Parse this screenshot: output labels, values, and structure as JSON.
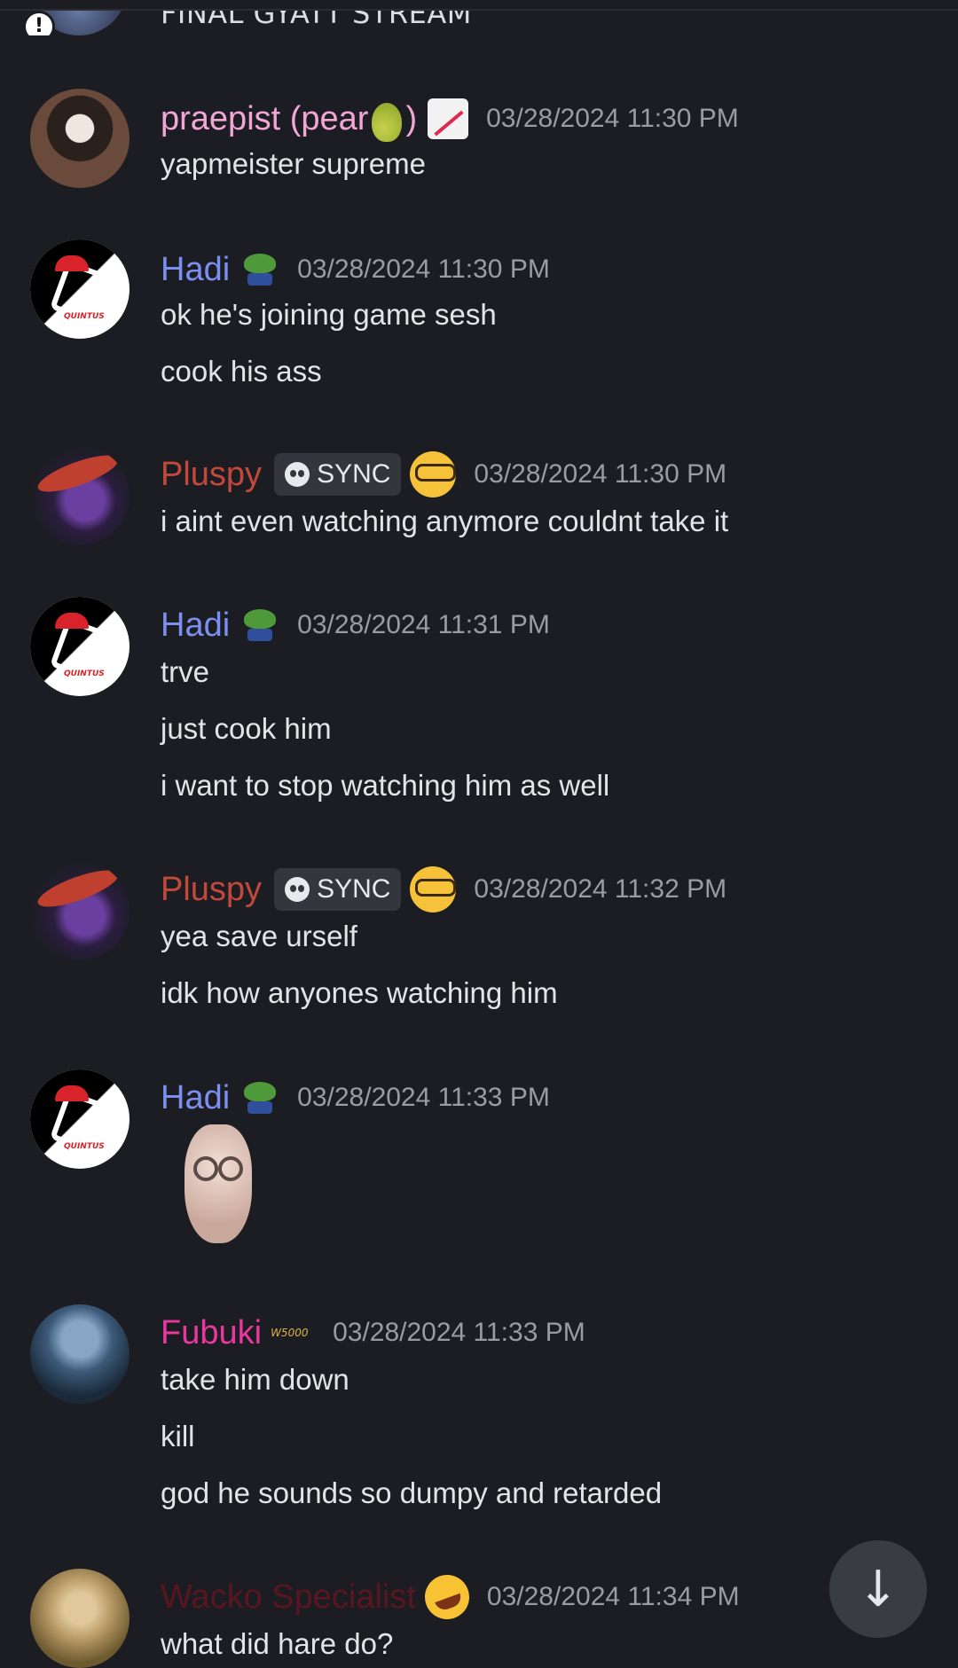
{
  "partial_message": {
    "text": "FINAL GYATT STREAM"
  },
  "messages": [
    {
      "username": "praepist (pear",
      "username_suffix": ")",
      "user_color": "#f1a6d6",
      "timestamp": "03/28/2024 11:30 PM",
      "lines": [
        "yapmeister supreme"
      ]
    },
    {
      "username": "Hadi",
      "user_color": "#7b8ff0",
      "timestamp": "03/28/2024 11:30 PM",
      "lines": [
        "ok he's joining game sesh",
        "cook his ass"
      ]
    },
    {
      "username": "Pluspy",
      "user_color": "#c3483c",
      "tag": "SYNC",
      "timestamp": "03/28/2024 11:30 PM",
      "lines": [
        "i aint even watching anymore couldnt take it"
      ]
    },
    {
      "username": "Hadi",
      "user_color": "#7b8ff0",
      "timestamp": "03/28/2024 11:31 PM",
      "lines": [
        "trve",
        "just cook him",
        "i want to stop watching him as well"
      ]
    },
    {
      "username": "Pluspy",
      "user_color": "#c3483c",
      "tag": "SYNC",
      "timestamp": "03/28/2024 11:32 PM",
      "lines": [
        "yea save urself",
        "idk how anyones watching him"
      ]
    },
    {
      "username": "Hadi",
      "user_color": "#7b8ff0",
      "timestamp": "03/28/2024 11:33 PM",
      "lines": []
    },
    {
      "username": "Fubuki",
      "user_color": "#e8389e",
      "badge_text": "W5000",
      "timestamp": "03/28/2024 11:33 PM",
      "lines": [
        "take him down",
        "kill",
        "god he sounds so dumpy and retarded"
      ]
    },
    {
      "username": "Wacko Specialist",
      "user_color": "#5a1620",
      "timestamp": "03/28/2024 11:34 PM",
      "lines": [
        "what did hare do?"
      ]
    }
  ],
  "avatar_brand": "QUINTUS",
  "scroll_button": {
    "icon": "arrow-down-icon",
    "glyph": "↓"
  }
}
